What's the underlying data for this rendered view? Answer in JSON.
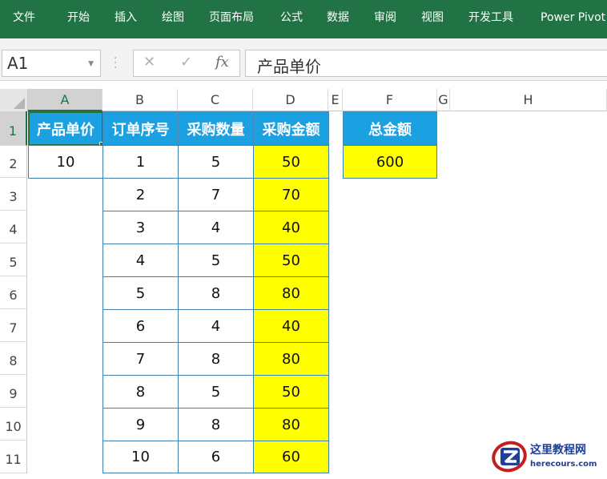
{
  "ribbon": {
    "tabs": [
      "文件",
      "开始",
      "插入",
      "绘图",
      "页面布局",
      "公式",
      "数据",
      "审阅",
      "视图",
      "开发工具",
      "Power Pivot"
    ]
  },
  "formula_bar": {
    "name_box": "A1",
    "cancel_icon": "✕",
    "enter_icon": "✓",
    "fx_label": "fx",
    "content": "产品单价"
  },
  "columns": [
    "A",
    "B",
    "C",
    "D",
    "E",
    "F",
    "G",
    "H"
  ],
  "rows": [
    "1",
    "2",
    "3",
    "4",
    "5",
    "6",
    "7",
    "8",
    "9",
    "10",
    "11"
  ],
  "sheet": {
    "a1": "产品单价",
    "a2": "10",
    "headers": {
      "b": "订单序号",
      "c": "采购数量",
      "d": "采购金额",
      "f": "总金额"
    },
    "orders": [
      {
        "no": "1",
        "qty": "5",
        "amt": "50"
      },
      {
        "no": "2",
        "qty": "7",
        "amt": "70"
      },
      {
        "no": "3",
        "qty": "4",
        "amt": "40"
      },
      {
        "no": "4",
        "qty": "5",
        "amt": "50"
      },
      {
        "no": "5",
        "qty": "8",
        "amt": "80"
      },
      {
        "no": "6",
        "qty": "4",
        "amt": "40"
      },
      {
        "no": "7",
        "qty": "8",
        "amt": "80"
      },
      {
        "no": "8",
        "qty": "5",
        "amt": "50"
      },
      {
        "no": "9",
        "qty": "8",
        "amt": "80"
      },
      {
        "no": "10",
        "qty": "6",
        "amt": "60"
      }
    ],
    "total": "600"
  },
  "watermark": {
    "title": "这里教程网",
    "url": "herecours.com"
  },
  "colors": {
    "ribbon": "#217346",
    "header_fill": "#1ba1e2",
    "highlight_fill": "#ffff00",
    "border": "#3f7fb0"
  }
}
